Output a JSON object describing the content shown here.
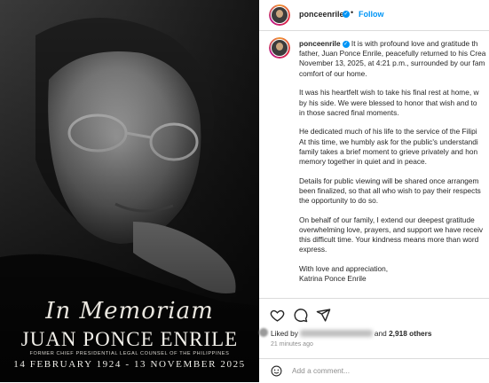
{
  "photo": {
    "memoriam_script": "In Memoriam",
    "name": "JUAN PONCE ENRILE",
    "title": "FORMER CHIEF PRESIDENTIAL LEGAL COUNSEL OF THE PHILIPPINES",
    "dates": "14 FEBRUARY 1924 - 13 NOVEMBER 2025"
  },
  "header": {
    "username": "ponceenrile",
    "separator": "•",
    "follow_label": "Follow"
  },
  "caption": {
    "username": "ponceenrile",
    "paragraphs": [
      [
        " It is with profound love and gratitude th",
        "father, Juan Ponce Enrile, peacefully returned to his Crea",
        "November 13, 2025, at 4:21 p.m., surrounded by our fam",
        "comfort of our home."
      ],
      [
        "It was his heartfelt wish to take his final rest at home, w",
        "by his side. We were blessed to honor that wish and to",
        "in those sacred final moments."
      ],
      [
        "He dedicated much of his life to the service of the Filipi",
        "At this time, we humbly ask for the public's understandi",
        "family takes a brief moment to grieve privately and hon",
        "memory together in quiet and in peace."
      ],
      [
        "Details for public viewing will be shared once arrangem",
        "been finalized, so that all who wish to pay their respects",
        "the opportunity to do so."
      ],
      [
        "On behalf of our family, I extend our deepest gratitude",
        "overwhelming love, prayers, and support we have receiv",
        "this difficult time. Your kindness means more than word",
        "express."
      ],
      [
        "With love and appreciation,",
        "Katrina Ponce Enrile"
      ]
    ]
  },
  "actions": {
    "icons": [
      "heart-icon",
      "comment-icon",
      "share-icon"
    ]
  },
  "likes": {
    "prefix": "Liked by",
    "joiner": "and",
    "count": "2,918 others"
  },
  "timestamp": "21 minutes ago",
  "comment": {
    "placeholder": "Add a comment..."
  },
  "colors": {
    "accent": "#0095f6",
    "text": "#262626",
    "muted": "#8e8e8e",
    "border": "#dbdbdb"
  }
}
